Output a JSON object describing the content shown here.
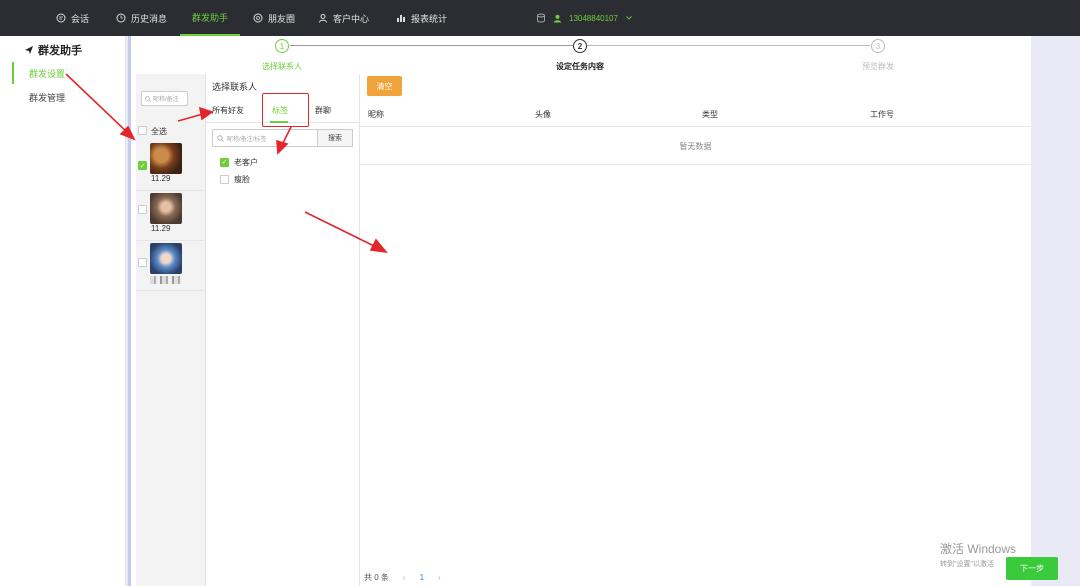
{
  "topnav": {
    "items": [
      {
        "label": "会话",
        "icon": "chat-icon"
      },
      {
        "label": "历史消息",
        "icon": "clock-icon"
      },
      {
        "label": "群发助手",
        "icon": ""
      },
      {
        "label": "朋友圈",
        "icon": "aperture-icon"
      },
      {
        "label": "客户中心",
        "icon": "user-icon"
      },
      {
        "label": "报表统计",
        "icon": "bar-chart-icon"
      }
    ],
    "active_index": 2,
    "account": "13048840107"
  },
  "sidebar": {
    "title": "群发助手",
    "items": [
      {
        "label": "群发设置",
        "active": true
      },
      {
        "label": "群发管理",
        "active": false
      }
    ]
  },
  "steps": [
    {
      "num": "1",
      "label": "选择联系人",
      "state": "active"
    },
    {
      "num": "2",
      "label": "设定任务内容",
      "state": "current"
    },
    {
      "num": "3",
      "label": "预览群发",
      "state": "pending"
    }
  ],
  "contacts_pane": {
    "search_placeholder": "昵称/备注",
    "select_all_label": "全选",
    "contacts": [
      {
        "name": "11.29",
        "checked": true
      },
      {
        "name": "11.29",
        "checked": false
      },
      {
        "name": "",
        "checked": false
      }
    ]
  },
  "select_pane": {
    "title": "选择联系人",
    "tabs": [
      "所有好友",
      "标签",
      "群聊"
    ],
    "active_tab": 1,
    "search_placeholder": "昵称/备注/标签",
    "search_button": "搜索",
    "labels": [
      {
        "name": "老客户",
        "checked": true
      },
      {
        "name": "瘦脸",
        "checked": false
      }
    ]
  },
  "selected_pane": {
    "clear_button": "清空",
    "columns": [
      "昵称",
      "头像",
      "类型",
      "工作号"
    ],
    "empty_text": "暂无数据",
    "pager": {
      "total": "共 0 条",
      "prev": "‹",
      "current": "1",
      "next": "›"
    }
  },
  "watermark": {
    "line1": "激活 Windows",
    "line2": "转到\"设置\"以激活"
  },
  "next_button": "下一步",
  "colors": {
    "accent": "#6ecf3a",
    "topbar": "#2b2d33",
    "clear_button": "#f0a33b",
    "annotation": "#e3262b",
    "next_button": "#3bca3b"
  }
}
